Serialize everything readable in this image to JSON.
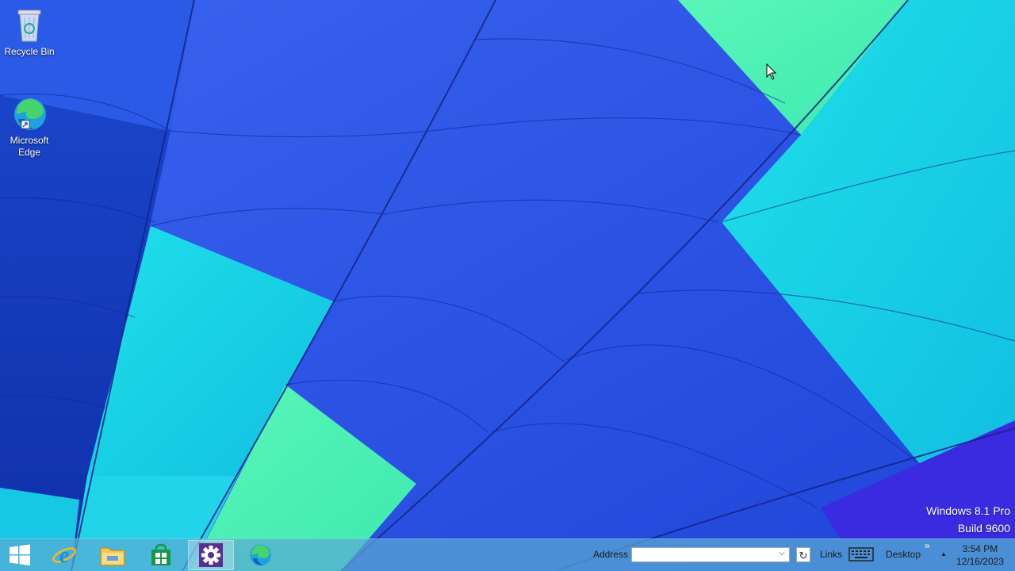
{
  "desktop": {
    "icons": [
      {
        "label": "Recycle Bin",
        "icon": "recycle-bin-icon"
      },
      {
        "label": "Microsoft Edge",
        "icon": "edge-icon"
      }
    ],
    "watermark": {
      "line1": "Windows 8.1 Pro",
      "line2": "Build 9600"
    }
  },
  "taskbar": {
    "pinned": [
      {
        "name": "Start",
        "icon": "windows-logo-icon"
      },
      {
        "name": "Internet Explorer",
        "icon": "internet-explorer-icon"
      },
      {
        "name": "File Explorer",
        "icon": "file-explorer-icon"
      },
      {
        "name": "Store",
        "icon": "store-icon"
      },
      {
        "name": "Settings",
        "icon": "gear-icon"
      },
      {
        "name": "Microsoft Edge",
        "icon": "edge-icon"
      }
    ],
    "address_label": "Address",
    "address_value": "",
    "links_label": "Links",
    "desktop_label": "Desktop",
    "overflow_glyph": "»",
    "tray_chevron": "▲",
    "clock": {
      "time": "3:54 PM",
      "date": "12/16/2023"
    }
  },
  "colors": {
    "taskbar": "#5aaad2",
    "wallpaper_blue": "#2a55e8",
    "wallpaper_cyan": "#18d6e6",
    "wallpaper_green": "#4ff2b0"
  }
}
